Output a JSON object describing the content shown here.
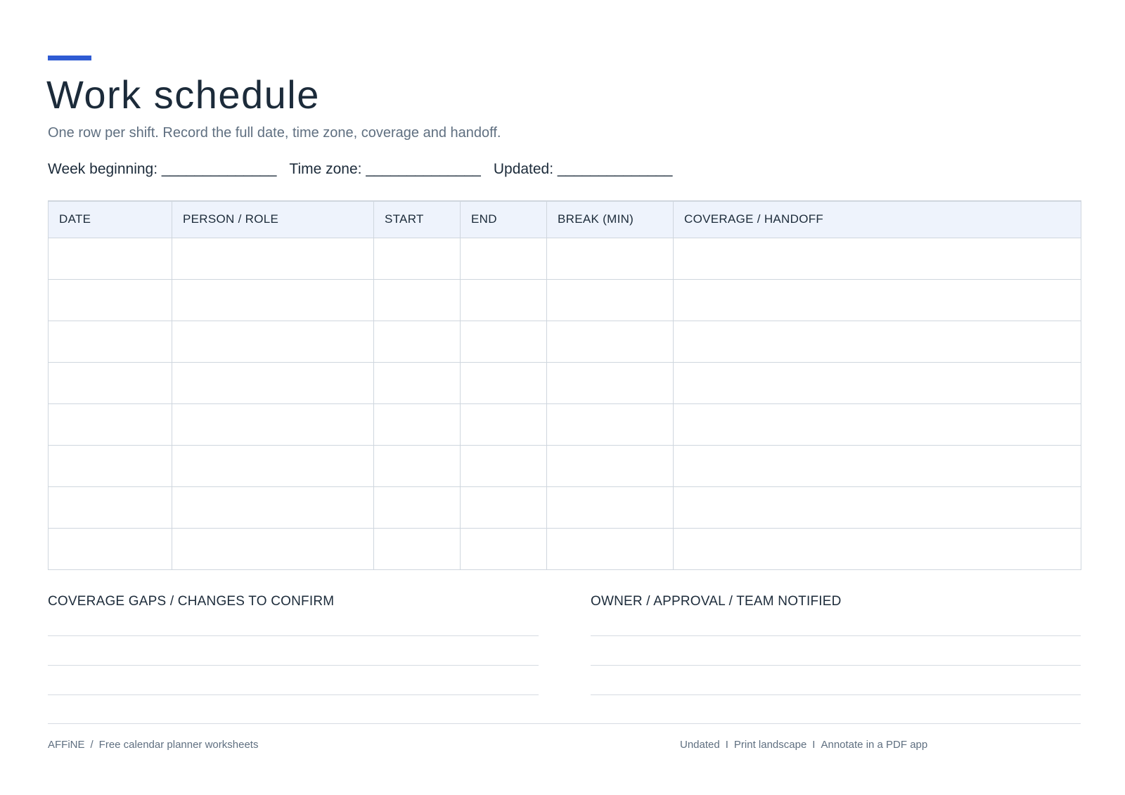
{
  "header": {
    "title": "Work schedule",
    "subtitle": "One row per shift. Record the full date, time zone, coverage and handoff."
  },
  "meta_fields": [
    "Week beginning: ______________",
    "Time zone: ______________",
    "Updated: ______________"
  ],
  "table": {
    "columns": [
      "DATE",
      "PERSON / ROLE",
      "START",
      "END",
      "BREAK (MIN)",
      "COVERAGE / HANDOFF"
    ],
    "row_count": 8
  },
  "notes": {
    "left_heading": "COVERAGE GAPS / CHANGES TO CONFIRM",
    "right_heading": "OWNER / APPROVAL / TEAM NOTIFIED"
  },
  "footer": {
    "brand": "AFFiNE",
    "brand_sep": "/",
    "tagline": "Free calendar planner worksheets",
    "right_items": [
      "Undated",
      "Print landscape",
      "Annotate in a PDF app"
    ],
    "right_sep": "I"
  },
  "colors": {
    "accent": "#2f5bd3",
    "header_fill": "#eef3fc",
    "text": "#1c2b3a",
    "muted": "#5f6f80"
  }
}
